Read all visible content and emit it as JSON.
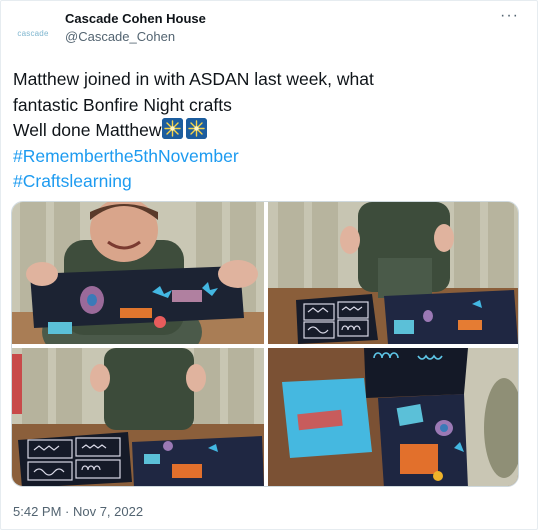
{
  "account": {
    "logo_text": "cascade",
    "display_name": "Cascade Cohen House",
    "handle": "@Cascade_Cohen"
  },
  "tweet": {
    "line1": "Matthew joined in with ASDAN last week, what",
    "line2": "fantastic Bonfire Night crafts",
    "line3": "Well done Matthew",
    "hashtag1": "#Rememberthe5thNovember",
    "hashtag2": "#Craftslearning",
    "emoji": [
      "sparkler-emoji",
      "sparkler-emoji"
    ],
    "timestamp": "5:42 PM · Nov 7, 2022"
  },
  "menu": {
    "icon": "more-horizontal-icon"
  },
  "media": {
    "count": 4,
    "photos": [
      "person-holding-bonfire-craft",
      "person-thumbs-up-with-crafts",
      "person-thumbs-up-at-table",
      "crafts-on-table-closeup"
    ]
  },
  "colors": {
    "link": "#1d9bf0",
    "secondary": "#536471",
    "text": "#0f1419"
  }
}
